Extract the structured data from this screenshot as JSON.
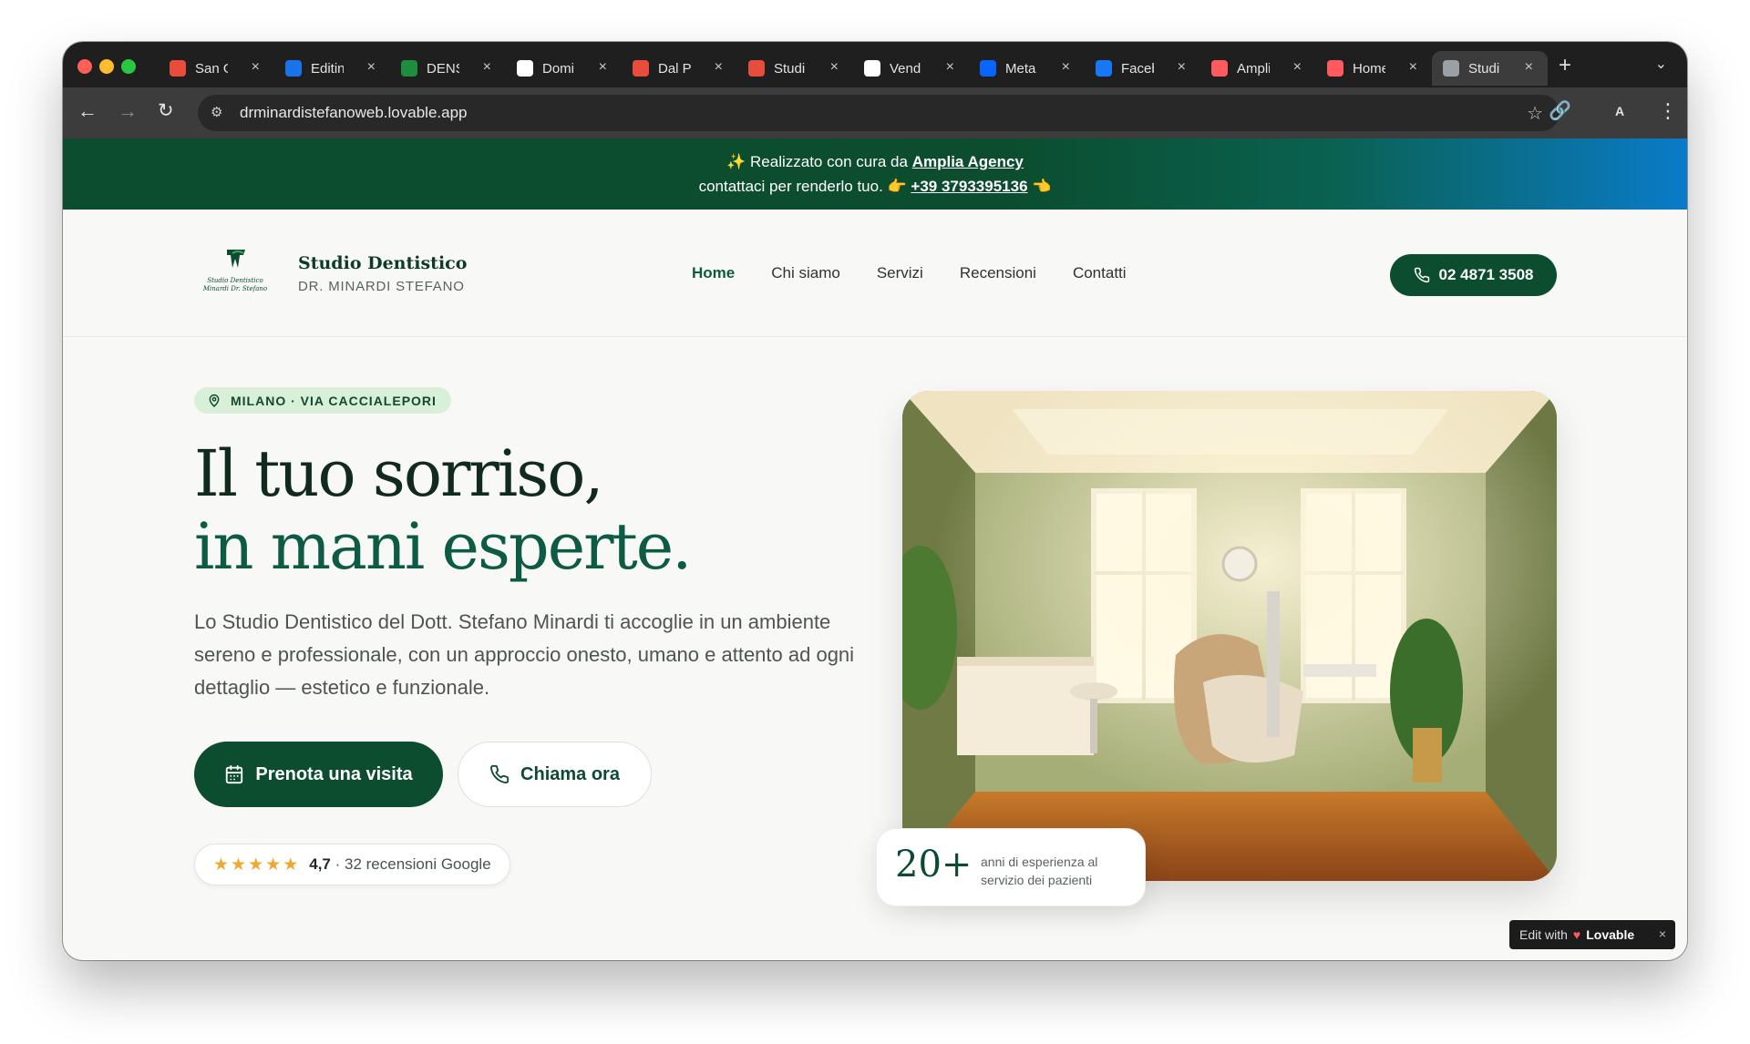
{
  "browser": {
    "tabs": [
      {
        "label": "San G",
        "icon": "maps-pin-icon",
        "color": "#e84c3d"
      },
      {
        "label": "Editin",
        "icon": "editor-icon",
        "color": "#1a73e8"
      },
      {
        "label": "DENS",
        "icon": "sheets-icon",
        "color": "#1e8e3e"
      },
      {
        "label": "Domi",
        "icon": "wix-icon",
        "color": "#ffffff"
      },
      {
        "label": "Dal P",
        "icon": "maps-pin-icon",
        "color": "#e84c3d"
      },
      {
        "label": "Studi",
        "icon": "maps-pin-icon",
        "color": "#e84c3d"
      },
      {
        "label": "Vend",
        "icon": "openai-icon",
        "color": "#ffffff"
      },
      {
        "label": "Meta",
        "icon": "meta-icon",
        "color": "#0866ff"
      },
      {
        "label": "Faceb",
        "icon": "facebook-icon",
        "color": "#1877f2"
      },
      {
        "label": "Ampli",
        "icon": "lovable-icon",
        "color": "#ff5a5f"
      },
      {
        "label": "Home",
        "icon": "lovable-icon",
        "color": "#ff5a5f"
      },
      {
        "label": "Studi",
        "icon": "globe-icon",
        "color": "#9aa0a6"
      }
    ],
    "url": "drminardistefanoweb.lovable.app"
  },
  "banner": {
    "line1": "Realizzato con cura da",
    "agency": "Amplia Agency",
    "line2": "contattaci per renderlo tuo. 👉",
    "phone": "+39 3793395136",
    "end": "👈"
  },
  "header": {
    "logo_text_1": "Studio Dentistico",
    "logo_text_2": "Minardi Dr. Stefano",
    "brand": "Studio Dentistico",
    "brand_sub": "DR. MINARDI STEFANO",
    "nav": [
      "Home",
      "Chi siamo",
      "Servizi",
      "Recensioni",
      "Contatti"
    ],
    "phone": "02 4871 3508"
  },
  "hero": {
    "location": "MILANO · VIA CACCIALEPORI",
    "title_1": "Il tuo sorriso,",
    "title_2": "in mani esperte.",
    "lead": "Lo Studio Dentistico del Dott. Stefano Minardi ti accoglie in un ambiente sereno e professionale, con un approccio onesto, umano e attento ad ogni dettaglio — estetico e funzionale.",
    "cta_primary": "Prenota una visita",
    "cta_secondary": "Chiama ora",
    "rating_value": "4,7",
    "rating_text": "· 32 recensioni Google",
    "stars": 5,
    "exp_number": "20+",
    "exp_text": "anni di esperienza al servizio dei pazienti"
  },
  "badge": {
    "prefix": "Edit with",
    "brand": "Lovable",
    "close": "×"
  },
  "colors": {
    "primary": "#0b4d2e",
    "accent": "#0d5b44",
    "pill_bg": "#d9f0d8",
    "star": "#f0a830"
  }
}
